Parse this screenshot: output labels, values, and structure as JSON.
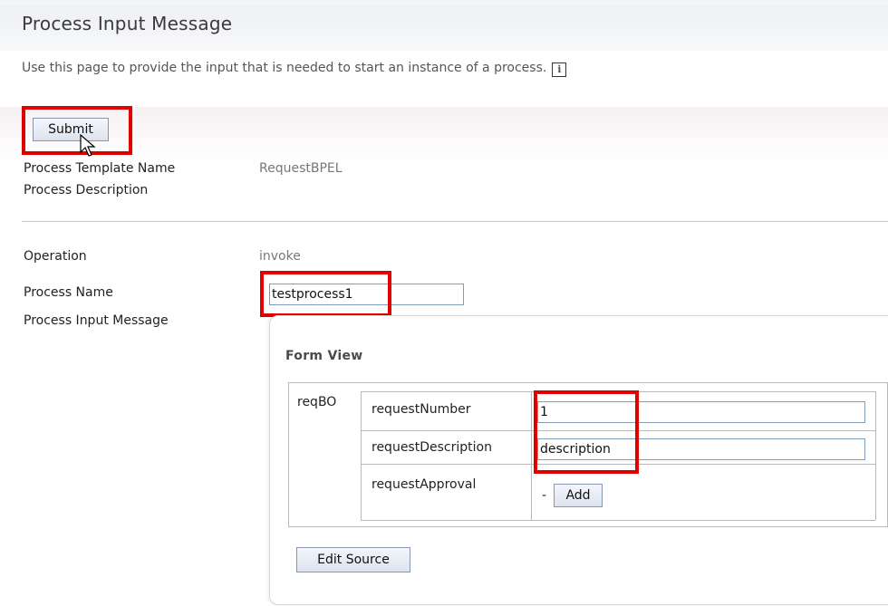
{
  "header": {
    "title": "Process Input Message",
    "intro": "Use this page to provide the input that is needed to start an instance of a process.",
    "info_icon": "i"
  },
  "toolbar": {
    "submit_label": "Submit"
  },
  "details": {
    "template_name_label": "Process Template Name",
    "template_name_value": "RequestBPEL",
    "description_label": "Process Description",
    "operation_label": "Operation",
    "operation_value": "invoke",
    "process_name_label": "Process Name",
    "process_name_value": "testprocess1",
    "input_message_label": "Process Input Message"
  },
  "form": {
    "title": "Form View",
    "bo_name": "reqBO",
    "fields": [
      {
        "label": "requestNumber",
        "value": "1"
      },
      {
        "label": "requestDescription",
        "value": "description"
      },
      {
        "label": "requestApproval",
        "prefix": "-",
        "add_label": "Add"
      }
    ],
    "edit_source_label": "Edit Source"
  },
  "colors": {
    "highlight": "#e00000",
    "input_border": "#7f9db9"
  }
}
